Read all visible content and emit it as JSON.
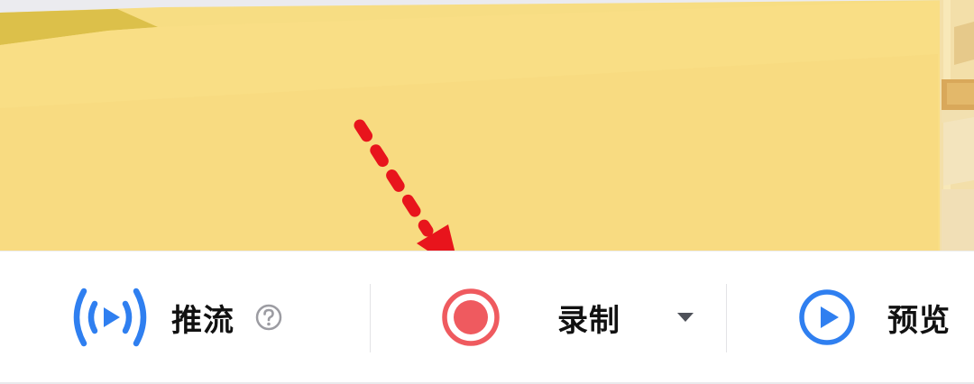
{
  "toolbar": {
    "push_stream": {
      "label": "推流",
      "icon": "broadcast-icon",
      "help_icon": "question-circle-icon"
    },
    "record": {
      "label": "录制",
      "icon": "record-icon",
      "dropdown_icon": "caret-down-icon"
    },
    "preview": {
      "label": "预览",
      "icon": "play-circle-icon"
    }
  },
  "colors": {
    "accent_blue": "#2f7ff0",
    "record_red": "#ef5a5f",
    "annotation_red": "#e8141c",
    "preview_yellow": "#f7dd83"
  }
}
